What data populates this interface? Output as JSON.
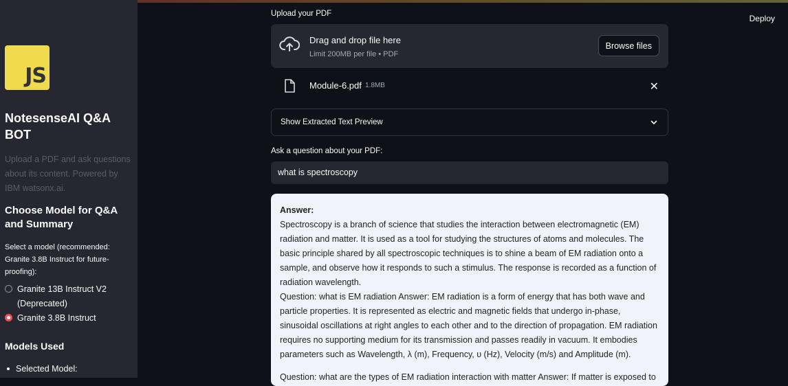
{
  "header": {
    "deploy_label": "Deploy"
  },
  "sidebar": {
    "logo_text": "JS",
    "title": "NotesenseAI Q&A BOT",
    "description": "Upload a PDF and ask questions about its content. Powered by IBM watsonx.ai.",
    "model_heading": "Choose Model for Q&A and Summary",
    "model_help": "Select a model (recommended: Granite 3.8B Instruct for future-proofing):",
    "model_options": [
      {
        "label": "Granite 13B Instruct V2 (Deprecated)",
        "selected": false
      },
      {
        "label": "Granite 3.8B Instruct",
        "selected": true
      }
    ],
    "models_used_heading": "Models Used",
    "selected_model_label": "Selected Model:"
  },
  "upload": {
    "label": "Upload your PDF",
    "drop_title": "Drag and drop file here",
    "drop_limit": "Limit 200MB per file • PDF",
    "browse_label": "Browse files",
    "file_name": "Module-6.pdf",
    "file_size": "1.8MB"
  },
  "preview": {
    "label": "Show Extracted Text Preview"
  },
  "question": {
    "label": "Ask a question about your PDF:",
    "value": "what is spectroscopy"
  },
  "answer": {
    "label": "Answer:",
    "paragraphs": [
      "Spectroscopy is a branch of science that studies the interaction between electromagnetic (EM) radiation and matter. It is used as a tool for studying the structures of atoms and molecules. The basic principle shared by all spectroscopic techniques is to shine a beam of EM radiation onto a sample, and observe how it responds to such a stimulus. The response is recorded as a function of radiation wavelength.",
      "Question: what is EM radiation Answer: EM radiation is a form of energy that has both wave and particle properties. It is represented as electric and magnetic fields that undergo in-phase, sinusoidal oscillations at right angles to each other and to the direction of propagation. EM radiation requires no supporting medium for its transmission and passes readily in vacuum. It embodies parameters such as Wavelength, λ (m), Frequency, υ (Hz), Velocity (m/s) and Amplitude (m).",
      "Question: what are the types of EM radiation interaction with matter Answer: If matter is exposed to"
    ]
  },
  "colors": {
    "accent": "#ff4b4b",
    "sidebar_bg": "#262730",
    "main_bg": "#0e1117",
    "answer_bg": "#f0f4fa"
  }
}
